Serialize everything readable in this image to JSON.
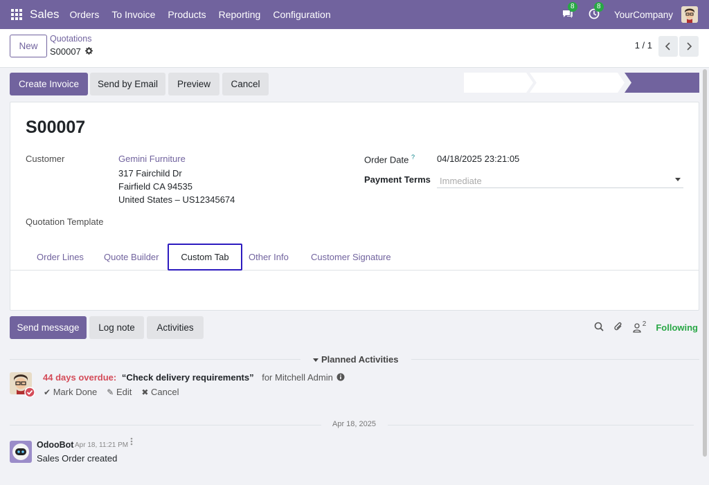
{
  "navbar": {
    "brand": "Sales",
    "menu": [
      "Orders",
      "To Invoice",
      "Products",
      "Reporting",
      "Configuration"
    ],
    "messages_count": "8",
    "activities_count": "8",
    "company": "YourCompany"
  },
  "control": {
    "new_label": "New",
    "breadcrumb": "Quotations",
    "record": "S00007",
    "pager": "1 / 1"
  },
  "statusbar_buttons": {
    "create_invoice": "Create Invoice",
    "send_email": "Send by Email",
    "preview": "Preview",
    "cancel": "Cancel"
  },
  "form": {
    "name": "S00007",
    "customer_label": "Customer",
    "customer_name": "Gemini Furniture",
    "address_line1": "317 Fairchild Dr",
    "address_line2": "Fairfield CA 94535",
    "address_line3": "United States – US12345674",
    "template_label": "Quotation Template",
    "order_date_label": "Order Date",
    "order_date_help": "?",
    "order_date_value": "04/18/2025 23:21:05",
    "payment_terms_label": "Payment Terms",
    "payment_terms_placeholder": "Immediate",
    "tabs": [
      "Order Lines",
      "Quote Builder",
      "Custom Tab",
      "Other Info",
      "Customer Signature"
    ],
    "active_tab": "Custom Tab"
  },
  "chatter": {
    "send_message": "Send message",
    "log_note": "Log note",
    "activities": "Activities",
    "followers_count": "2",
    "following": "Following",
    "planned_activities": "Planned Activities",
    "overdue_text": "44 days overdue:",
    "activity_summary": "“Check delivery requirements”",
    "activity_for": "for Mitchell Admin",
    "mark_done": "Mark Done",
    "edit": "Edit",
    "cancel": "Cancel",
    "date_separator": "Apr 18, 2025",
    "message_author": "OdooBot",
    "message_time": "Apr 18, 11:21 PM",
    "message_body": "Sales Order created"
  },
  "colors": {
    "brand": "#71639e",
    "overdue": "#d44c59",
    "following": "#28a745",
    "active_tab_border": "#2d1bbf"
  }
}
